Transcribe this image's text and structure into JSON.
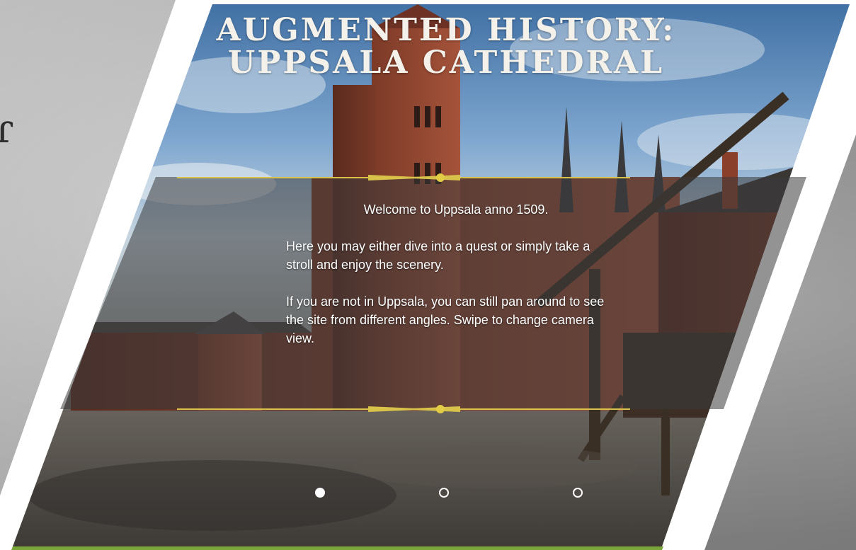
{
  "title": {
    "line1": "AUGMENTED HISTORY:",
    "line2": "UPPSALA CATHEDRAL"
  },
  "info": {
    "welcome": "Welcome to Uppsala anno 1509.",
    "paragraph2": "Here you may either dive into a quest or simply take a stroll and enjoy the scenery.",
    "paragraph3": "If you are not in Uppsala, you can still pan around to see the site from different angles. Swipe to change camera view."
  },
  "pagination": {
    "pages": [
      {
        "label": "page-1",
        "active": true
      },
      {
        "label": "page-2",
        "active": false
      },
      {
        "label": "page-3",
        "active": false
      }
    ]
  },
  "colors": {
    "accent_gold": "#d8c24a",
    "green_strip": "#7aa63a",
    "sky": "#6f9bc8",
    "brick": "#8a3f2a"
  },
  "icons": {
    "divider_ornament": "gold-diamond-divider-icon",
    "background_glyph": "script-letter-icon"
  }
}
